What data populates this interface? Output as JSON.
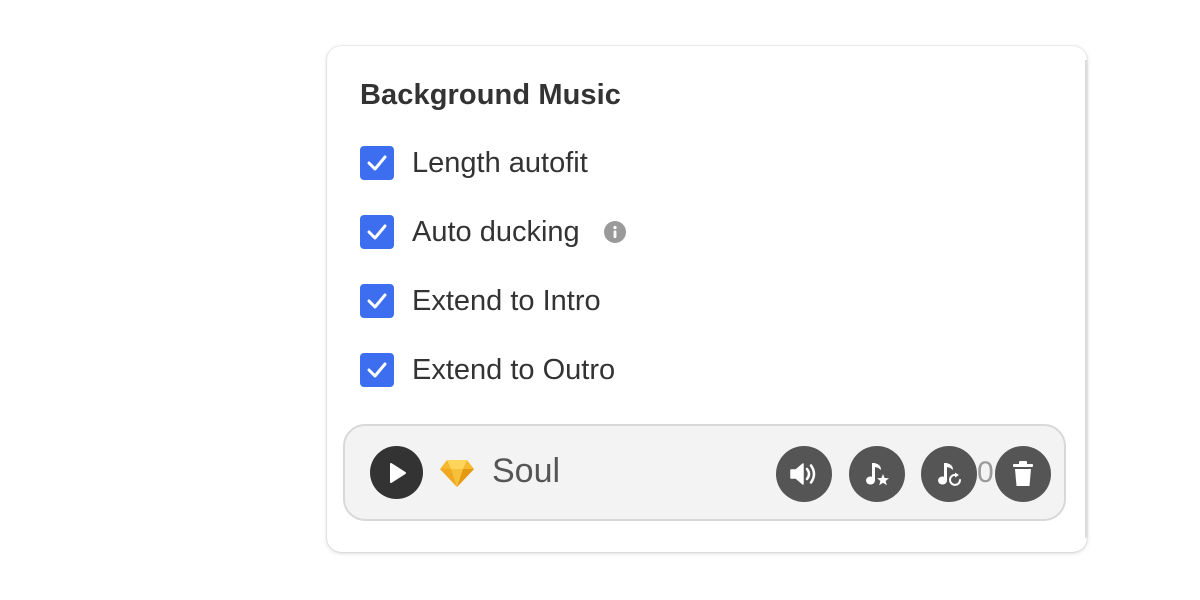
{
  "panel": {
    "title": "Background Music"
  },
  "options": [
    {
      "label": "Length autofit",
      "checked": true
    },
    {
      "label": "Auto ducking",
      "checked": true,
      "has_info": true
    },
    {
      "label": "Extend to Intro",
      "checked": true
    },
    {
      "label": "Extend to Outro",
      "checked": true
    }
  ],
  "track": {
    "name": "Soul",
    "overlap_text": "0",
    "icons": [
      "play-icon",
      "gem-icon",
      "volume-icon",
      "music-star-icon",
      "music-replace-icon",
      "trash-icon"
    ]
  },
  "colors": {
    "checkbox": "#3d6ef0",
    "text": "#333333",
    "track_button": "#555555",
    "gem": "#f5b82e"
  }
}
